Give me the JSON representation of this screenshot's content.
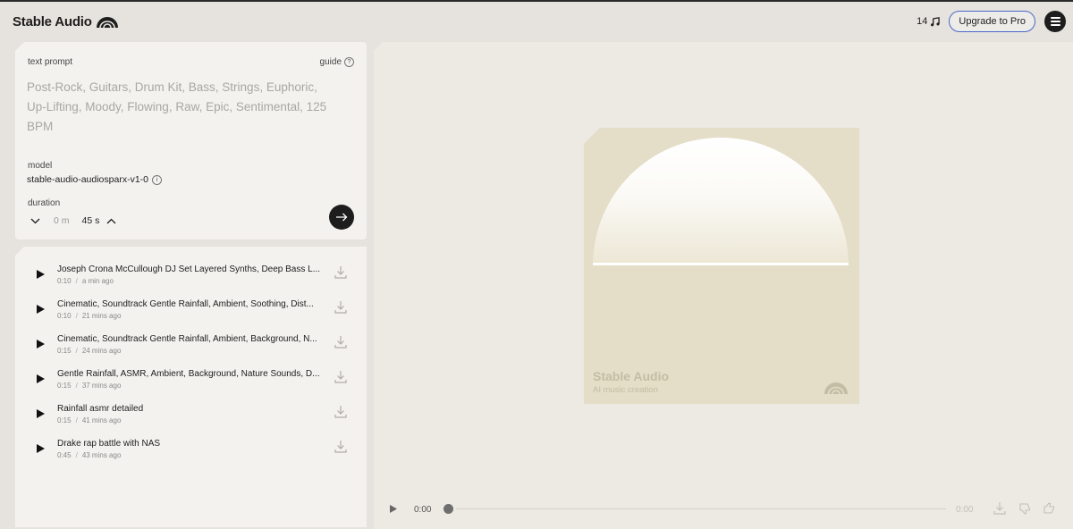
{
  "header": {
    "logo_text": "Stable Audio",
    "credits": "14",
    "upgrade_label": "Upgrade to Pro"
  },
  "prompt": {
    "label": "text prompt",
    "guide_label": "guide",
    "placeholder": "Post-Rock, Guitars, Drum Kit, Bass, Strings, Euphoric, Up-Lifting, Moody, Flowing, Raw, Epic, Sentimental, 125 BPM",
    "model_label": "model",
    "model_value": "stable-audio-audiosparx-v1-0",
    "duration_label": "duration",
    "duration_minutes": "0 m",
    "duration_seconds": "45 s"
  },
  "tracks": [
    {
      "title": "Joseph Crona McCullough DJ Set Layered Synths, Deep Bass L...",
      "length": "0:10",
      "time": "a min ago"
    },
    {
      "title": "Cinematic, Soundtrack Gentle Rainfall, Ambient, Soothing, Dist...",
      "length": "0:10",
      "time": "21 mins ago"
    },
    {
      "title": "Cinematic, Soundtrack Gentle Rainfall, Ambient, Background, N...",
      "length": "0:15",
      "time": "24 mins ago"
    },
    {
      "title": "Gentle Rainfall, ASMR, Ambient, Background, Nature Sounds, D...",
      "length": "0:15",
      "time": "37 mins ago"
    },
    {
      "title": "Rainfall asmr detailed",
      "length": "0:15",
      "time": "41 mins ago"
    },
    {
      "title": "Drake rap battle with NAS",
      "length": "0:45",
      "time": "43 mins ago"
    }
  ],
  "artwork": {
    "title": "Stable Audio",
    "subtitle": "AI music creation"
  },
  "player": {
    "current_time": "0:00",
    "duration": "0:00"
  },
  "colors": {
    "background": "#e6e3de",
    "panel": "#f4f2ef",
    "artwork": "#e4ddc7",
    "accent_border": "#4a66c8",
    "dark": "#1d1d1d"
  }
}
